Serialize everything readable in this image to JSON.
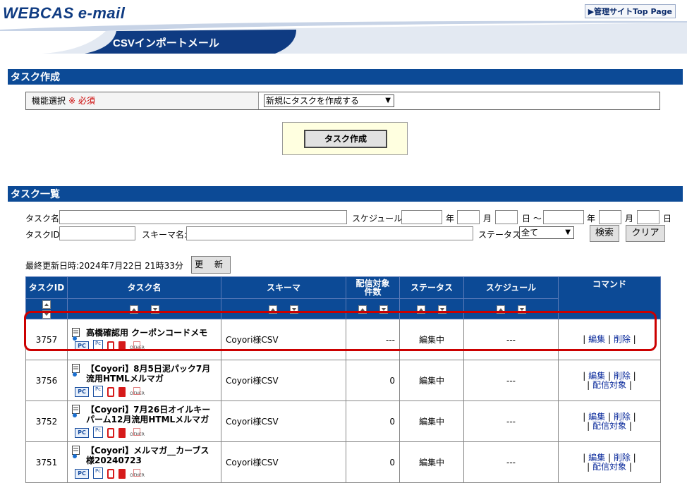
{
  "header": {
    "logo_main": "WEBCAS",
    "logo_sub": "e-mail",
    "top_link": "▶管理サイトTop Page",
    "page_title": "CSVインポートメール"
  },
  "create_section": {
    "title": "タスク作成",
    "func_label": "機能選択",
    "required_mark": "※ 必須",
    "func_select_value": "新規にタスクを作成する",
    "create_button": "タスク作成"
  },
  "list_section": {
    "title": "タスク一覧",
    "search": {
      "task_name_label": "タスク名:",
      "task_id_label": "タスクID:",
      "schema_label": "スキーマ名:",
      "schedule_label": "スケジュール:",
      "year_label": "年",
      "month_label": "月",
      "day_label": "日 〜",
      "day_label_end": "日",
      "status_label": "ステータス:",
      "status_value": "全て",
      "search_button": "検索",
      "clear_button": "クリア"
    },
    "last_updated": "最終更新日時:2024年7月22日 21時33分",
    "update_button": "更 新",
    "columns": [
      "タスクID",
      "タスク名",
      "スキーマ",
      "配信対象件数",
      "ステータス",
      "スケジュール",
      "コマンド"
    ],
    "column_count_line1": "配信対象",
    "column_count_line2": "件数",
    "icon_other_label": "OTHER",
    "icon_pc_label": "PC",
    "icon_sp_label": "Pc",
    "rows": [
      {
        "id": "3757",
        "name": "高橋確認用 クーポンコードメモ",
        "schema": "Coyori様CSV",
        "count": "---",
        "status": "編集中",
        "schedule": "---",
        "cmd_edit": "編集",
        "cmd_delete": "削除",
        "cmd_target": ""
      },
      {
        "id": "3756",
        "name": "【Coyori】8月5日泥パック7月流用HTMLメルマガ",
        "schema": "Coyori様CSV",
        "count": "0",
        "status": "編集中",
        "schedule": "---",
        "cmd_edit": "編集",
        "cmd_delete": "削除",
        "cmd_target": "配信対象"
      },
      {
        "id": "3752",
        "name": "【Coyori】7月26日オイルキーパーム12月流用HTMLメルマガ",
        "schema": "Coyori様CSV",
        "count": "0",
        "status": "編集中",
        "schedule": "---",
        "cmd_edit": "編集",
        "cmd_delete": "削除",
        "cmd_target": "配信対象"
      },
      {
        "id": "3751",
        "name": "【Coyori】メルマガ__カーブス様20240723",
        "schema": "Coyori様CSV",
        "count": "0",
        "status": "編集中",
        "schedule": "---",
        "cmd_edit": "編集",
        "cmd_delete": "削除",
        "cmd_target": "配信対象"
      }
    ]
  },
  "colors": {
    "section_bar": "#0c4a96",
    "highlight": "#cc0000",
    "create_box_bg": "#ffffe0"
  }
}
